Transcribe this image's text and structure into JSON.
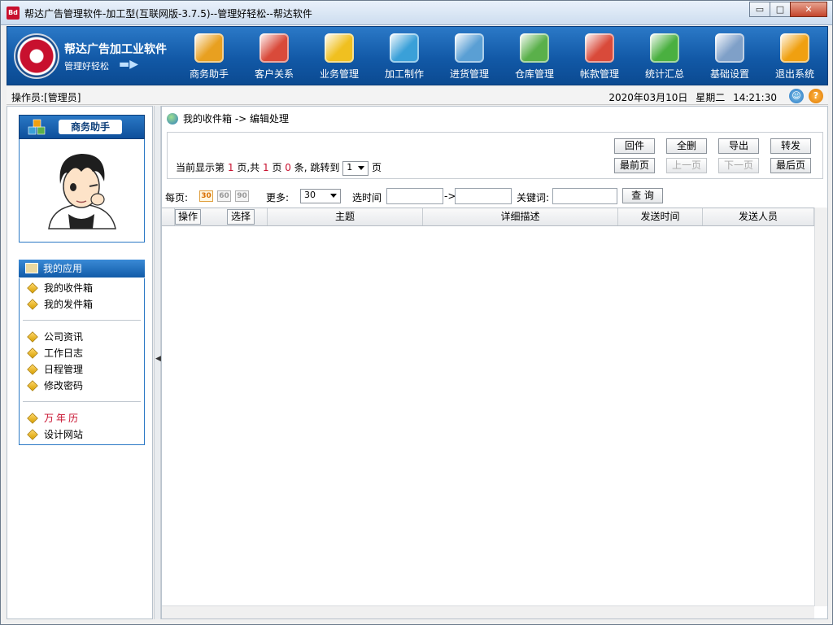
{
  "window": {
    "title": "帮达广告管理软件-加工型(互联网版-3.7.5)--管理好轻松--帮达软件",
    "app_icon": "Bd"
  },
  "brand": {
    "title": "帮达广告加工业软件",
    "subtitle": "管理好轻松"
  },
  "toolbar": [
    {
      "label": "商务助手",
      "icon": "pen-check-icon",
      "color": "#e8a020"
    },
    {
      "label": "客户关系",
      "icon": "people-icon",
      "color": "#d94a3a"
    },
    {
      "label": "业务管理",
      "icon": "clipboard-icon",
      "color": "#f0c020"
    },
    {
      "label": "加工制作",
      "icon": "cubes-icon",
      "color": "#3aa0d8"
    },
    {
      "label": "进货管理",
      "icon": "notepad-icon",
      "color": "#5a9fd4"
    },
    {
      "label": "仓库管理",
      "icon": "warehouse-icon",
      "color": "#5ab04a"
    },
    {
      "label": "帐款管理",
      "icon": "exchange-icon",
      "color": "#d94a3a"
    },
    {
      "label": "统计汇总",
      "icon": "chart-icon",
      "color": "#4ab040"
    },
    {
      "label": "基础设置",
      "icon": "settings-doc-icon",
      "color": "#7fa0c8"
    },
    {
      "label": "退出系统",
      "icon": "exit-person-icon",
      "color": "#f0a010"
    }
  ],
  "status": {
    "operator": "操作员:[管理员]",
    "date": "2020年03月10日",
    "weekday": "星期二",
    "time": "14:21:30"
  },
  "sidebar": {
    "assistant_title": "商务助手",
    "apps_title": "我的应用",
    "group1": [
      "我的收件箱",
      "我的发件箱"
    ],
    "group2": [
      "公司资讯",
      "工作日志",
      "日程管理",
      "修改密码"
    ],
    "group3_red": "万年历",
    "group3": [
      "设计网站"
    ]
  },
  "main": {
    "breadcrumb": "我的收件箱 -> 编辑处理",
    "buttons_row1": [
      "回件",
      "全删",
      "导出",
      "转发"
    ],
    "buttons_row2": [
      "最前页",
      "上一页",
      "下一页",
      "最后页"
    ],
    "pager": {
      "prefix": "当前显示第",
      "current": "1",
      "mid1": "页,共",
      "pages": "1",
      "mid2": "页",
      "count": "0",
      "mid3": "条,  跳转到",
      "jump_value": "1",
      "suffix": "页"
    },
    "filter": {
      "per_page_label": "每页:",
      "per_page_options": [
        "30",
        "60",
        "90"
      ],
      "more_label": "更多:",
      "more_value": "30",
      "time_label": "选时间",
      "arrow": "->",
      "keyword_label": "关键词:",
      "query_button": "查 询"
    },
    "columns": [
      "操作",
      "选择",
      "主题",
      "详细描述",
      "发送时间",
      "发送人员"
    ]
  }
}
